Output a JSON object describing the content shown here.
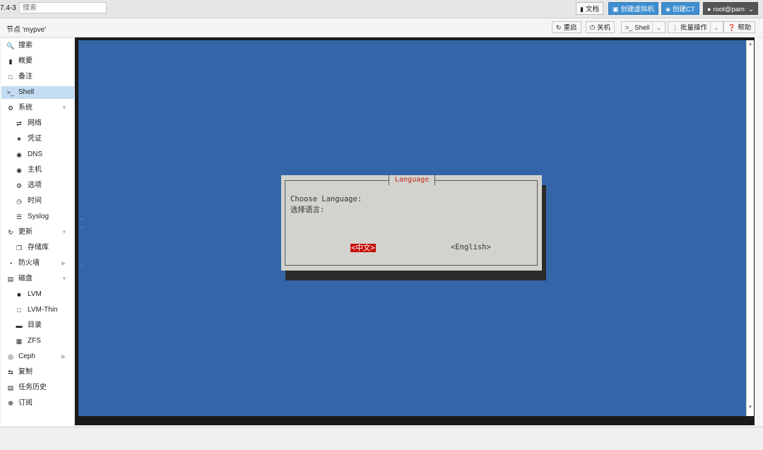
{
  "header": {
    "version": "7.4-3",
    "search_placeholder": "搜索",
    "docs_label": "文档",
    "create_vm_label": "创建虚拟机",
    "create_ct_label": "创建CT",
    "user_label": "root@pam"
  },
  "subbar": {
    "node_title": "节点 'mypve'",
    "reboot_label": "重启",
    "shutdown_label": "关机",
    "shell_label": "Shell",
    "bulk_label": "批量操作",
    "help_label": "帮助"
  },
  "sidebar": {
    "items": [
      {
        "label": "搜索",
        "icon": "search-icon"
      },
      {
        "label": "概要",
        "icon": "book-icon"
      },
      {
        "label": "备注",
        "icon": "note-icon"
      },
      {
        "label": "Shell",
        "icon": "terminal-icon"
      },
      {
        "label": "系统",
        "icon": "gears-icon"
      },
      {
        "label": "网络",
        "icon": "exchange-icon"
      },
      {
        "label": "凭证",
        "icon": "certificate-icon"
      },
      {
        "label": "DNS",
        "icon": "globe-icon"
      },
      {
        "label": "主机",
        "icon": "globe-icon"
      },
      {
        "label": "选项",
        "icon": "gear-icon"
      },
      {
        "label": "时间",
        "icon": "clock-icon"
      },
      {
        "label": "Syslog",
        "icon": "list-icon"
      },
      {
        "label": "更新",
        "icon": "refresh-icon"
      },
      {
        "label": "存储库",
        "icon": "files-icon"
      },
      {
        "label": "防火墙",
        "icon": "shield-icon"
      },
      {
        "label": "磁盘",
        "icon": "hdd-icon"
      },
      {
        "label": "LVM",
        "icon": "square-icon"
      },
      {
        "label": "LVM-Thin",
        "icon": "square-outline-icon"
      },
      {
        "label": "目录",
        "icon": "folder-icon"
      },
      {
        "label": "ZFS",
        "icon": "grid-icon"
      },
      {
        "label": "Ceph",
        "icon": "ceph-icon"
      },
      {
        "label": "复制",
        "icon": "retweet-icon"
      },
      {
        "label": "任务历史",
        "icon": "list-alt-icon"
      },
      {
        "label": "订阅",
        "icon": "support-icon"
      }
    ],
    "selected_index": 3
  },
  "terminal": {
    "dialog_title": "Language",
    "prompt_line1": "Choose Language:",
    "prompt_line2": "选择语言:",
    "option_chinese": "<中文>",
    "option_english": "<English>"
  },
  "colors": {
    "terminal_bg": "#3465a8",
    "dialog_bg": "#d3d3cd",
    "selected_option": "#c4120c",
    "dialog_title": "#c0281e",
    "accent_blue": "#3e8ed0",
    "sidebar_selected": "#c3dcf2"
  }
}
